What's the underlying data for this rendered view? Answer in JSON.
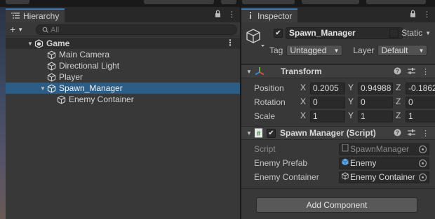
{
  "hierarchy": {
    "tab_label": "Hierarchy",
    "search_placeholder": "All",
    "add_label": "+",
    "scene_name": "Game",
    "items": [
      {
        "label": "Main Camera"
      },
      {
        "label": "Directional Light"
      },
      {
        "label": "Player"
      },
      {
        "label": "Spawn_Manager"
      },
      {
        "label": "Enemy Container"
      }
    ]
  },
  "inspector": {
    "tab_label": "Inspector",
    "object_name": "Spawn_Manager",
    "static_label": "Static",
    "tag_label": "Tag",
    "tag_value": "Untagged",
    "layer_label": "Layer",
    "layer_value": "Default",
    "transform": {
      "title": "Transform",
      "position_label": "Position",
      "rotation_label": "Rotation",
      "scale_label": "Scale",
      "axes": [
        "X",
        "Y",
        "Z"
      ],
      "position": [
        "0.2005",
        "0.94988",
        "-0.1862"
      ],
      "rotation": [
        "0",
        "0",
        "0"
      ],
      "scale": [
        "1",
        "1",
        "1"
      ]
    },
    "script_component": {
      "title": "Spawn Manager (Script)",
      "script_label": "Script",
      "script_value": "SpawnManager",
      "enemy_prefab_label": "Enemy Prefab",
      "enemy_prefab_value": "Enemy",
      "enemy_container_label": "Enemy Container",
      "enemy_container_value": "Enemy Container"
    },
    "add_component_label": "Add Component"
  },
  "colors": {
    "selection": "#2c5d87",
    "tab_accent": "#3a79bb",
    "panel_bg": "#383838"
  }
}
